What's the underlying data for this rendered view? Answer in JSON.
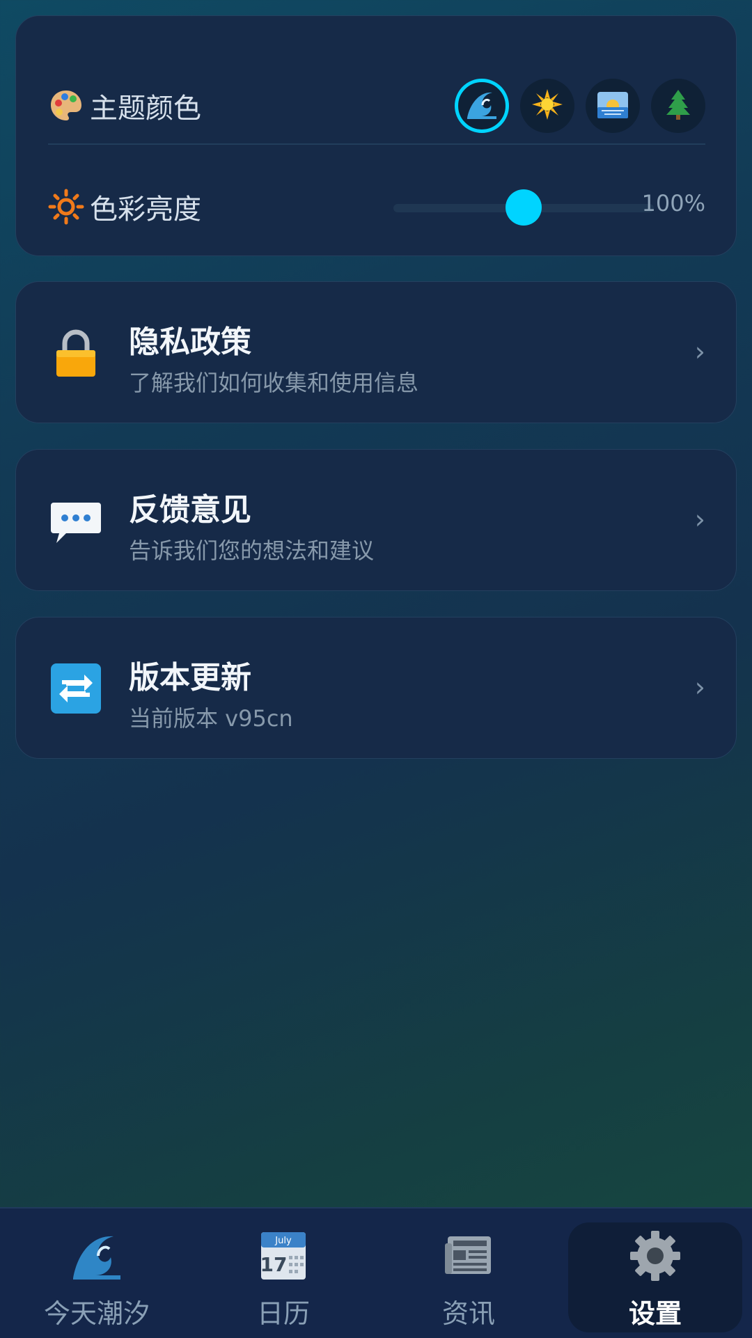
{
  "settings": {
    "theme_color": {
      "label": "主题颜色",
      "icon": "palette-icon",
      "options": [
        {
          "name": "ocean",
          "icon": "wave-icon",
          "selected": true
        },
        {
          "name": "sun",
          "icon": "sun-icon",
          "selected": false
        },
        {
          "name": "sunrise",
          "icon": "sunrise-icon",
          "selected": false
        },
        {
          "name": "forest",
          "icon": "tree-icon",
          "selected": false
        }
      ],
      "accent": "#00d4ff"
    },
    "brightness": {
      "label": "色彩亮度",
      "icon": "brightness-icon",
      "value": 0.5,
      "value_text": "100%"
    }
  },
  "list": [
    {
      "title": "隐私政策",
      "subtitle": "了解我们如何收集和使用信息",
      "icon": "lock-icon",
      "chevron": "›"
    },
    {
      "title": "反馈意见",
      "subtitle": "告诉我们您的想法和建议",
      "icon": "speech-bubble-icon",
      "chevron": "›"
    },
    {
      "title": "版本更新",
      "subtitle": "当前版本 v95cn",
      "icon": "refresh-icon",
      "chevron": "›"
    }
  ],
  "nav": {
    "items": [
      {
        "label": "今天潮汐",
        "icon": "wave-icon"
      },
      {
        "label": "日历",
        "icon": "calendar-icon",
        "calendar_month": "July",
        "calendar_day": "17"
      },
      {
        "label": "资讯",
        "icon": "newspaper-icon"
      },
      {
        "label": "设置",
        "icon": "gear-icon",
        "active": true
      }
    ]
  }
}
